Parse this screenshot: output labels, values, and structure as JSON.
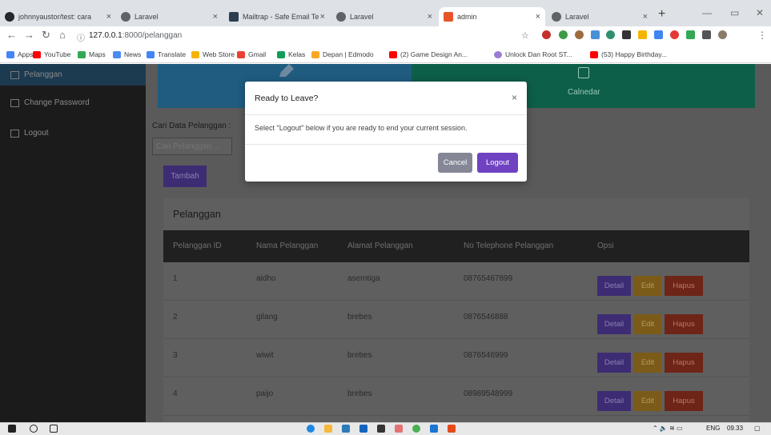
{
  "browser": {
    "tabs": [
      {
        "title": "johnnyaustor/test: cara",
        "color": "#24292e"
      },
      {
        "title": "Laravel",
        "color": "#5f6368"
      },
      {
        "title": "Mailtrap - Safe Email Te",
        "color": "#2c3e50"
      },
      {
        "title": "Laravel",
        "color": "#5f6368"
      },
      {
        "title": "admin",
        "color": "#e8542a"
      },
      {
        "title": "Laravel",
        "color": "#5f6368"
      }
    ],
    "new_tab": "+",
    "url_host": "127.0.0.1",
    "url_path": ":8000/pelanggan",
    "bookmarks": [
      {
        "label": "Apps",
        "color": "#4285f4"
      },
      {
        "label": "YouTube",
        "color": "#ff0000"
      },
      {
        "label": "Maps",
        "color": "#34a853"
      },
      {
        "label": "News",
        "color": "#4c8bf5"
      },
      {
        "label": "Translate",
        "color": "#4285f4"
      },
      {
        "label": "Web Store",
        "color": "#f4b400"
      },
      {
        "label": "Gmail",
        "color": "#ea4335"
      },
      {
        "label": "Kelas",
        "color": "#0f9d58"
      },
      {
        "label": "Depan | Edmodo",
        "color": "#f9a825"
      },
      {
        "label": "(2) Game Design An...",
        "color": "#ff0000"
      },
      {
        "label": "Unlock Dan Root ST...",
        "color": "#9c7bd6"
      },
      {
        "label": "(53) Happy Birthday...",
        "color": "#ff0000"
      }
    ]
  },
  "sidebar": {
    "items": [
      {
        "label": "Pelanggan"
      },
      {
        "label": "Change Password"
      },
      {
        "label": "Logout"
      }
    ]
  },
  "cards": {
    "green_label": "Calnedar"
  },
  "search": {
    "label": "Cari Data Pelanggan :",
    "placeholder": "Cari Pelanggan ..."
  },
  "tambah_label": "Tambah",
  "panel": {
    "title": "Pelanggan",
    "headers": [
      "Pelanggan ID",
      "Nama Pelanggan",
      "Alamat Pelanggan",
      "No Telephone Pelanggan",
      "Opsi"
    ],
    "rows": [
      {
        "id": "1",
        "nama": "aidho",
        "alamat": "asemtiga",
        "telp": "08765467899"
      },
      {
        "id": "2",
        "nama": "gilang",
        "alamat": "brebes",
        "telp": "0876546888"
      },
      {
        "id": "3",
        "nama": "wiwit",
        "alamat": "brebes",
        "telp": "0876546999"
      },
      {
        "id": "4",
        "nama": "paijo",
        "alamat": "brebes",
        "telp": "08989548999"
      }
    ],
    "actions": {
      "detail": "Detail",
      "edit": "Edit",
      "hapus": "Hapus"
    }
  },
  "modal": {
    "title": "Ready to Leave?",
    "body": "Select \"Logout\" below if you are ready to end your current session.",
    "cancel": "Cancel",
    "logout": "Logout",
    "close": "×"
  },
  "tray": {
    "lang": "ENG",
    "time": "09.33"
  }
}
